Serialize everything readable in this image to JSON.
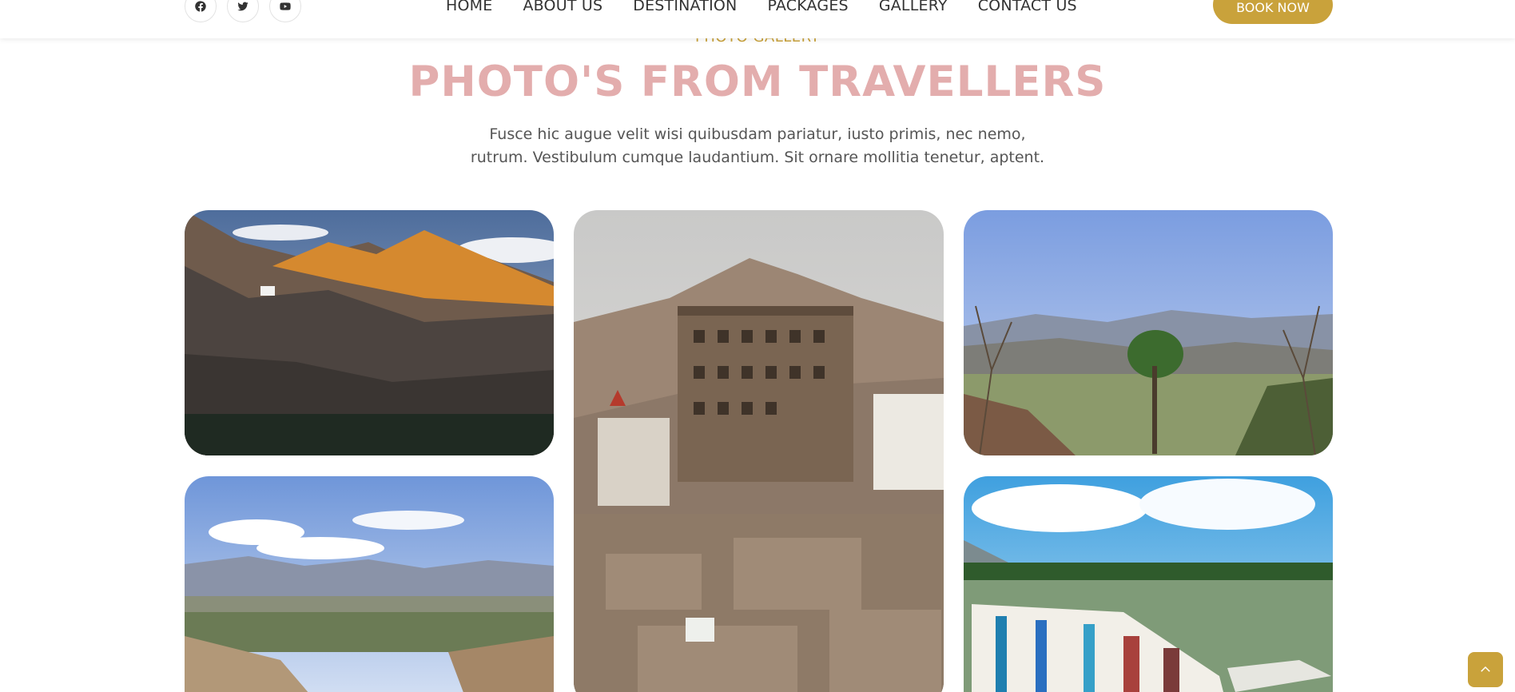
{
  "header": {
    "socials": [
      {
        "icon": "facebook-icon"
      },
      {
        "icon": "twitter-icon"
      },
      {
        "icon": "youtube-icon"
      }
    ],
    "nav": [
      "HOME",
      "ABOUT US",
      "DESTINATION",
      "PACKAGES",
      "GALLERY",
      "CONTACT US"
    ],
    "book_label": "BOOK NOW"
  },
  "gallery": {
    "subtitle": "PHOTO GALLERY",
    "title": "PHOTO'S FROM TRAVELLERS",
    "description_line1": "Fusce hic augue velit wisi quibusdam pariatur, iusto primis, nec nemo,",
    "description_line2": "rutrum. Vestibulum cumque laudantium. Sit ornare mollitia tenetur, aptent."
  },
  "colors": {
    "accent": "#c9a23b",
    "title": "#e3adad",
    "text": "#555555"
  },
  "scroll_top_icon": "chevron-up-icon"
}
